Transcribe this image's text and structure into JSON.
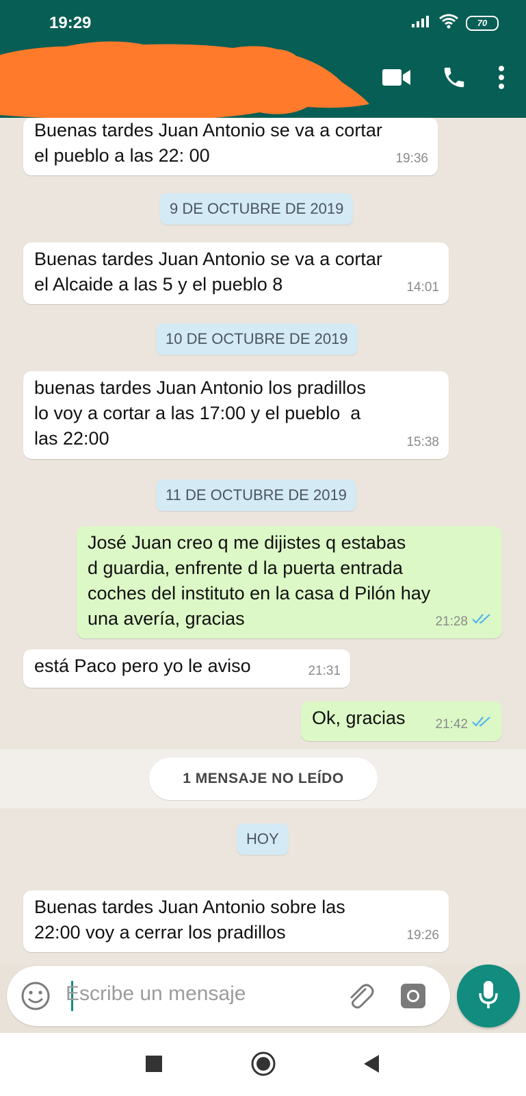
{
  "status_bar": {
    "time": "19:29",
    "battery": "70"
  },
  "header": {
    "icons": [
      "video-call-icon",
      "phone-icon",
      "more-options-icon"
    ]
  },
  "chat": {
    "messages": [
      {
        "type": "in",
        "text": "Buenas tardes Juan Antonio se va a cortar\nel pueblo a las 22: 00",
        "time": "19:36"
      },
      {
        "type": "date",
        "text": "9 DE OCTUBRE DE 2019"
      },
      {
        "type": "in",
        "text": "Buenas tardes Juan Antonio se va a cortar\nel Alcaide a las 5 y el pueblo 8",
        "time": "14:01"
      },
      {
        "type": "date",
        "text": "10 DE OCTUBRE DE 2019"
      },
      {
        "type": "in",
        "text": "buenas tardes Juan Antonio los pradillos\nlo voy a cortar a las 17:00 y el pueblo  a\nlas 22:00",
        "time": "15:38"
      },
      {
        "type": "date",
        "text": "11 DE OCTUBRE DE 2019"
      },
      {
        "type": "out",
        "text": "José Juan creo q me dijistes q estabas\nd guardia, enfrente d la puerta entrada\ncoches del instituto en la casa d Pilón hay\nuna avería, gracias",
        "time": "21:28"
      },
      {
        "type": "in",
        "text": "está Paco pero yo le aviso",
        "time": "21:31"
      },
      {
        "type": "out",
        "text": "Ok, gracias",
        "time": "21:42"
      },
      {
        "type": "unread",
        "text": "1 MENSAJE NO LEÍDO"
      },
      {
        "type": "date",
        "text": "HOY"
      },
      {
        "type": "in",
        "text": "Buenas tardes Juan Antonio sobre las\n22:00 voy a cerrar los pradillos",
        "time": "19:26"
      }
    ]
  },
  "composer": {
    "placeholder": "Escribe un mensaje"
  },
  "colors": {
    "header": "#075e54",
    "accent": "#128c7e",
    "outgoing": "#dcf8c6",
    "date_chip": "#d4eaf4",
    "redaction": "#ff7a2a"
  }
}
